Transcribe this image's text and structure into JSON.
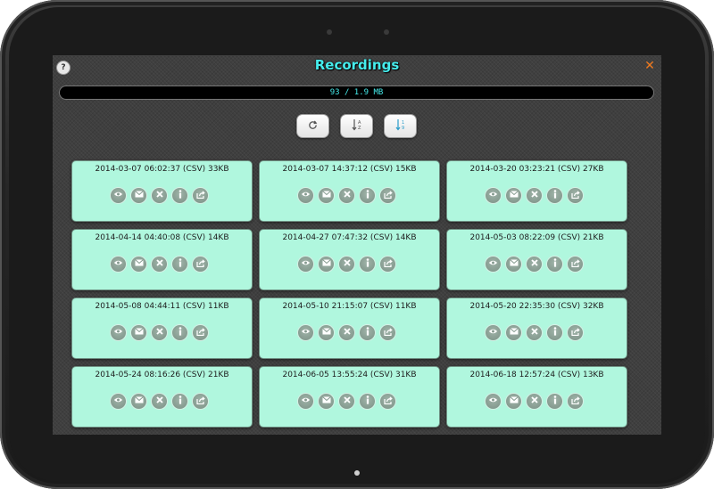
{
  "app": {
    "title": "Recordings",
    "help_glyph": "?",
    "close_glyph": "✕"
  },
  "storage": {
    "text": "93 / 1.9 MB"
  },
  "toolbar": {
    "refresh_glyph": "⟳",
    "sort_name_glyph": "↓",
    "sort_date_glyph": "↓"
  },
  "colors": {
    "accent": "#45ecec",
    "card_bg": "#b0f7de",
    "close": "#f07a1f"
  },
  "icons": {
    "view": "eye-icon",
    "email": "envelope-icon",
    "delete": "x-icon",
    "info": "info-icon",
    "share": "share-icon"
  },
  "recordings": [
    {
      "label": "2014-03-07 06:02:37 (CSV) 33KB"
    },
    {
      "label": "2014-03-07 14:37:12 (CSV) 15KB"
    },
    {
      "label": "2014-03-20 03:23:21 (CSV) 27KB"
    },
    {
      "label": "2014-04-14 04:40:08 (CSV) 14KB"
    },
    {
      "label": "2014-04-27 07:47:32 (CSV) 14KB"
    },
    {
      "label": "2014-05-03 08:22:09 (CSV) 21KB"
    },
    {
      "label": "2014-05-08 04:44:11 (CSV) 11KB"
    },
    {
      "label": "2014-05-10 21:15:07 (CSV) 11KB"
    },
    {
      "label": "2014-05-20 22:35:30 (CSV) 32KB"
    },
    {
      "label": "2014-05-24 08:16:26 (CSV) 21KB"
    },
    {
      "label": "2014-06-05 13:55:24 (CSV) 31KB"
    },
    {
      "label": "2014-06-18 12:57:24 (CSV) 13KB"
    }
  ]
}
